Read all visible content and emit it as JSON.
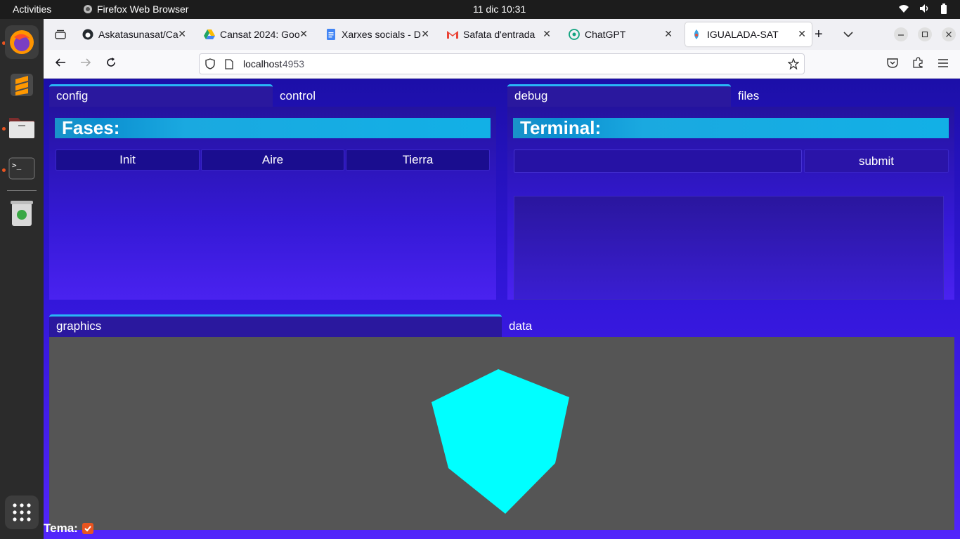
{
  "system": {
    "activities": "Activities",
    "app_name": "Firefox Web Browser",
    "clock": "11 dic  10:31"
  },
  "browser": {
    "tabs": [
      {
        "title": "Askatasunasat/Ca",
        "icon": "github-icon"
      },
      {
        "title": "Cansat 2024: Goo",
        "icon": "google-drive-icon"
      },
      {
        "title": "Xarxes socials - D",
        "icon": "google-docs-icon"
      },
      {
        "title": "Safata d'entrada",
        "icon": "gmail-icon"
      },
      {
        "title": "ChatGPT",
        "icon": "chatgpt-icon"
      },
      {
        "title": "IGUALADA-SAT",
        "icon": "site-icon"
      }
    ],
    "url_host": "localhost",
    "url_port": ":4953"
  },
  "app": {
    "left_tabs": [
      "config",
      "control"
    ],
    "right_tabs": [
      "debug",
      "files"
    ],
    "bottom_tabs": [
      "graphics",
      "data"
    ],
    "fases_title": "Fases:",
    "fases_buttons": [
      "Init",
      "Aire",
      "Tierra"
    ],
    "terminal_title": "Terminal:",
    "terminal_input_value": "",
    "submit_label": "submit",
    "theme_label": "Tema:",
    "theme_checked": true,
    "cube_color": "#00ffff"
  }
}
